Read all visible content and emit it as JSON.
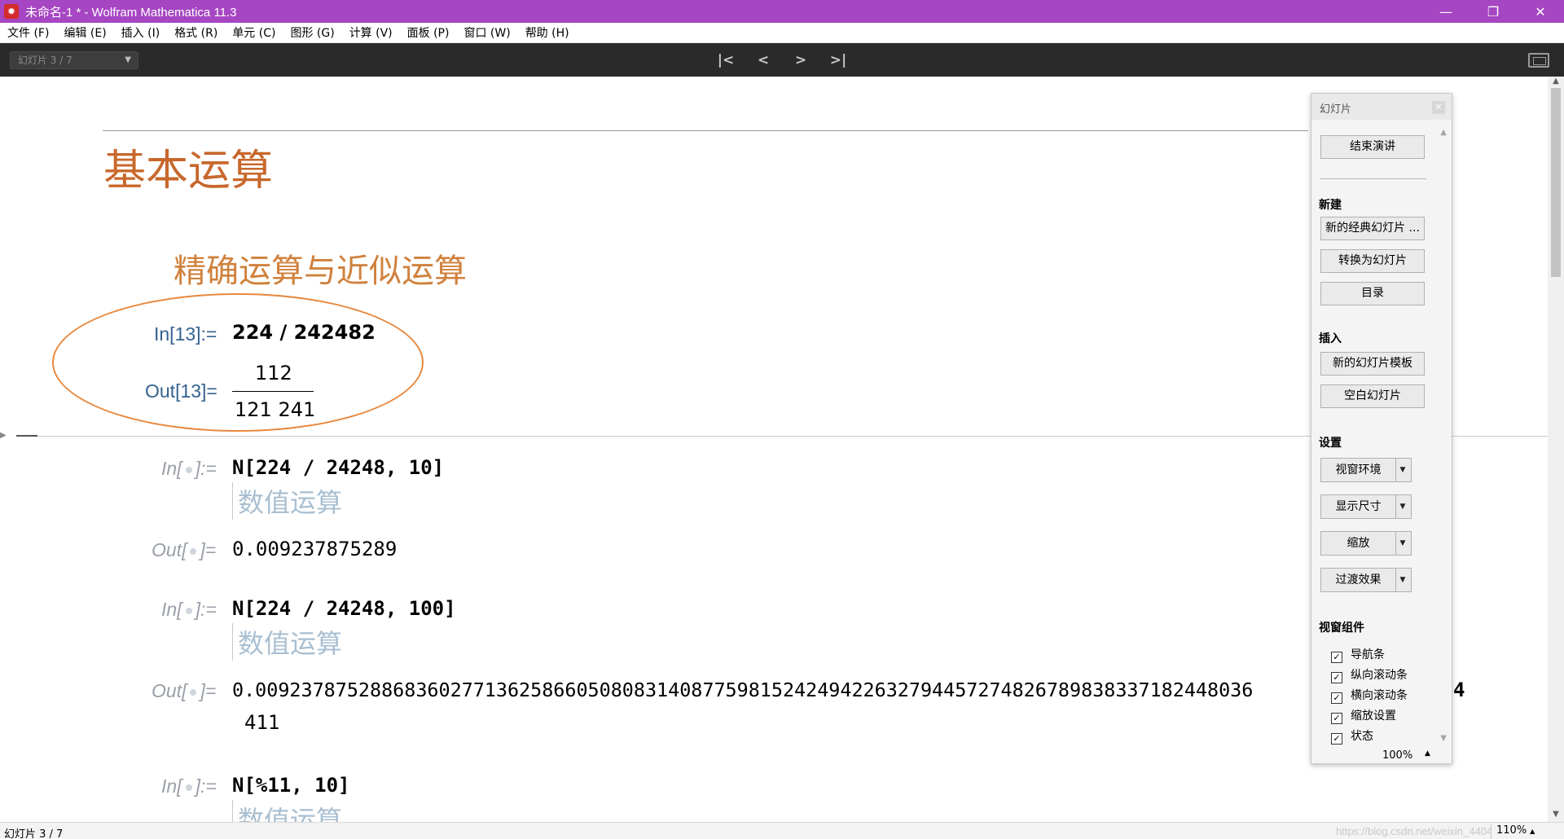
{
  "window": {
    "title": "未命名-1 * - Wolfram Mathematica 11.3",
    "controls": {
      "minimize": "—",
      "restore": "❐",
      "close": "✕"
    }
  },
  "menu": [
    "文件 (F)",
    "编辑 (E)",
    "插入 (I)",
    "格式 (R)",
    "单元 (C)",
    "图形 (G)",
    "计算 (V)",
    "面板 (P)",
    "窗口 (W)",
    "帮助 (H)"
  ],
  "toolbar": {
    "slide_selector": "幻灯片 3 / 7",
    "nav": {
      "first": "|<",
      "prev": "<",
      "next": ">",
      "last": ">|"
    }
  },
  "notebook": {
    "title": "基本运算",
    "section": "精确运算与近似运算",
    "cells": [
      {
        "in_label": "In[13]:=",
        "input": "224 / 242482",
        "out_label": "Out[13]=",
        "output_num": "112",
        "output_den": "121 241"
      },
      {
        "in_label_pre": "In[",
        "in_label_post": "]:=",
        "input": "N[224 / 24248, 10]",
        "comment": "数值运算",
        "out_label_pre": "Out[",
        "out_label_post": "]=",
        "output": "0.009237875289"
      },
      {
        "in_label_pre": "In[",
        "in_label_post": "]:=",
        "input": "N[224 / 24248, 100]",
        "comment": "数值运算",
        "out_label_pre": "Out[",
        "out_label_post": "]=",
        "output_line1": "0.009237875288683602771362586605080831408775981524249422632794457274826789838337182448036",
        "output_line1_tail": "4",
        "output_line2": "411"
      },
      {
        "in_label_pre": "In[",
        "in_label_post": "]:=",
        "input": "N[%11, 10]",
        "comment": "数值运算"
      }
    ]
  },
  "palette": {
    "title": "幻灯片",
    "end_button": "结束演讲",
    "sections": {
      "new": "新建",
      "insert": "插入",
      "settings": "设置",
      "window_elements": "视窗组件"
    },
    "new_buttons": [
      "新的经典幻灯片 ...",
      "转换为幻灯片",
      "目录"
    ],
    "insert_buttons": [
      "新的幻灯片模板",
      "空白幻灯片"
    ],
    "settings_dropdowns": [
      "视窗环境",
      "显示尺寸",
      "缩放",
      "过渡效果"
    ],
    "checkboxes": [
      {
        "label": "导航条",
        "checked": true
      },
      {
        "label": "纵向滚动条",
        "checked": true
      },
      {
        "label": "横向滚动条",
        "checked": true
      },
      {
        "label": "缩放设置",
        "checked": true
      },
      {
        "label": "状态",
        "checked": true
      }
    ],
    "zoom": "100%"
  },
  "status": {
    "left": "幻灯片 3 / 7",
    "watermark": "https://blog.csdn.net/weixin_44043185",
    "zoom": "110%"
  },
  "colors": {
    "titlebar": "#a646c2",
    "toolbar": "#2a2a2a",
    "slide_title": "#c8682c",
    "label_blue": "#34628f",
    "comment": "#a9bfd1",
    "ellipse": "#e8873c"
  }
}
